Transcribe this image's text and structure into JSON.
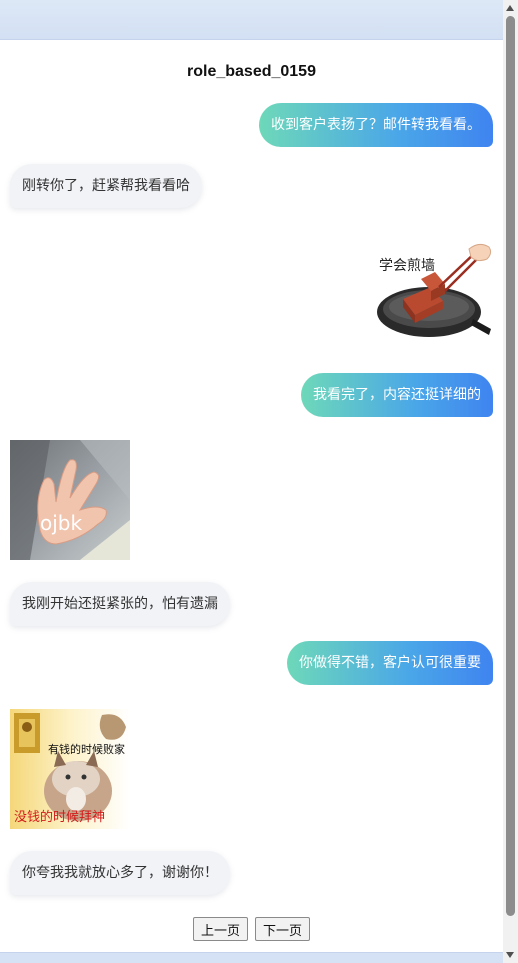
{
  "chat": {
    "title": "role_based_0159",
    "messages": [
      {
        "side": "right",
        "text": "收到客户表扬了？邮件转我看看。"
      },
      {
        "side": "left",
        "text": "刚转你了，赶紧帮我看看哈"
      },
      {
        "side": "right",
        "sticker_caption": "学会煎墙"
      },
      {
        "side": "right",
        "text": "我看完了，内容还挺详细的"
      },
      {
        "side": "left",
        "sticker_caption": "ojbk"
      },
      {
        "side": "left",
        "text": "我刚开始还挺紧张的，怕有遗漏"
      },
      {
        "side": "right",
        "text": "你做得不错，客户认可很重要"
      },
      {
        "side": "left",
        "sticker_caption_top": "有钱的时候败家",
        "sticker_caption_bottom": "没钱的时候拜神"
      },
      {
        "side": "left",
        "text": "你夸我我就放心多了，谢谢你！"
      }
    ]
  },
  "pager": {
    "prev_label": "上一页",
    "next_label": "下一页"
  },
  "colors": {
    "bubble_right_start": "#6ed8b9",
    "bubble_right_end": "#3f84f0",
    "bubble_left_bg": "#f1f3f7",
    "top_band": "#d3e0f4"
  },
  "icons": [
    "scroll-up-arrow-icon",
    "scroll-down-arrow-icon"
  ]
}
